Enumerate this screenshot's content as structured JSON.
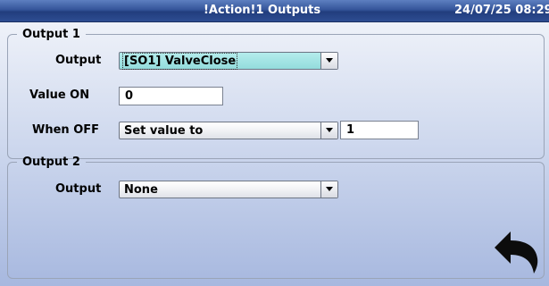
{
  "header": {
    "title": "!Action!1 Outputs",
    "datetime": "24/07/25 08:29"
  },
  "output1": {
    "legend": "Output 1",
    "output_label": "Output",
    "output_value": "[SO1] ValveClose",
    "value_on_label": "Value ON",
    "value_on": "0",
    "when_off_label": "When OFF",
    "when_off_value": "Set value to",
    "when_off_number": "1"
  },
  "output2": {
    "legend": "Output 2",
    "output_label": "Output",
    "output_value": "None"
  },
  "icons": {
    "dropdown": "chevron-down-icon",
    "back": "back-arrow-icon"
  },
  "colors": {
    "title_bar": "#2e4d92",
    "selected_combo": "#a5e3e3"
  }
}
